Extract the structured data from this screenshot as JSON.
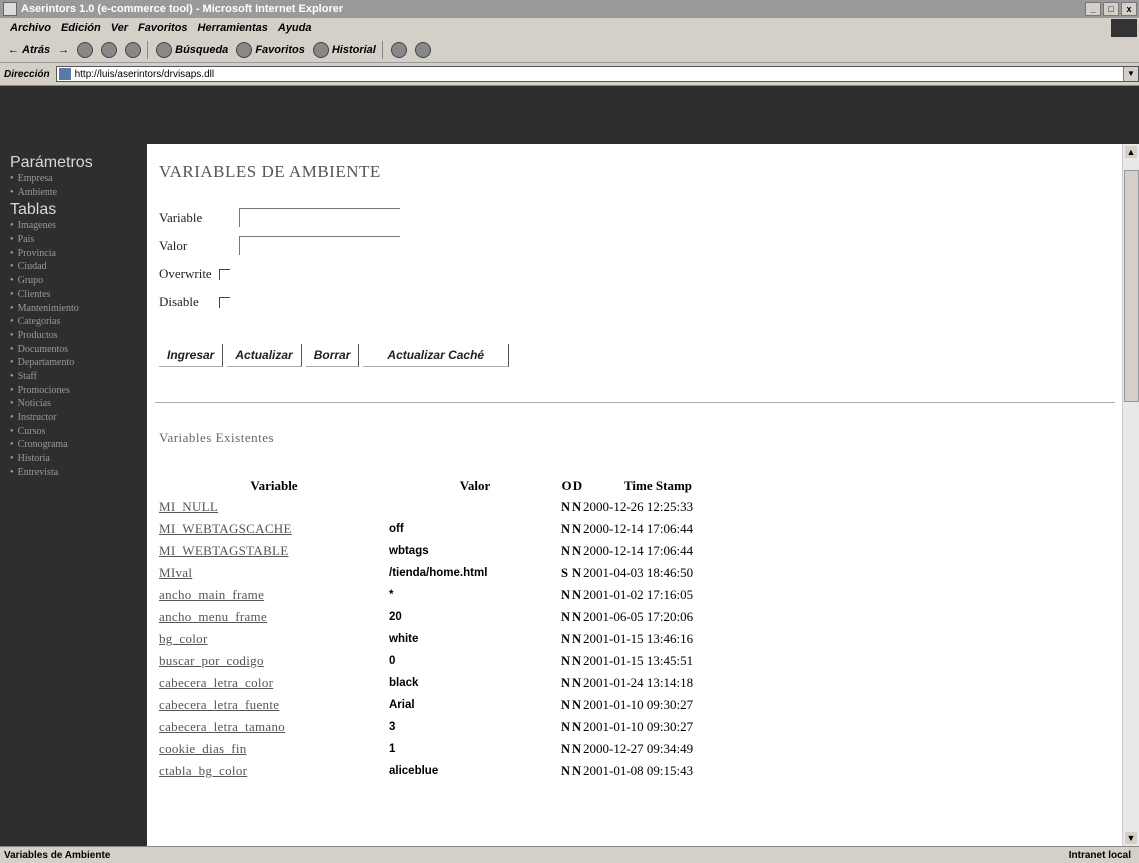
{
  "window": {
    "title": "Aserintors 1.0 (e-commerce tool) - Microsoft Internet Explorer",
    "controls": [
      "_",
      "□",
      "x"
    ]
  },
  "menubar": {
    "items": [
      "Archivo",
      "Edición",
      "Ver",
      "Favoritos",
      "Herramientas",
      "Ayuda"
    ]
  },
  "toolbar": {
    "back_label": "Atrás",
    "search_label": "Búsqueda",
    "favorites_label": "Favoritos",
    "history_label": "Historial"
  },
  "address": {
    "label": "Dirección",
    "url": "http://luis/aserintors/drvisaps.dll"
  },
  "sidebar": {
    "section1_title": "Parámetros",
    "section1_items": [
      "Empresa",
      "Ambiente"
    ],
    "section2_title": "Tablas",
    "section2_items": [
      "Imagenes",
      "Pais",
      "Provincia",
      "Ciudad",
      "Grupo",
      "Clientes",
      "Mantenimiento",
      "Categorias",
      "Productos",
      "Documentos",
      "Departamento",
      "Staff",
      "Promociones",
      "Noticias",
      "Instructor",
      "Cursos",
      "Cronograma",
      "Historia",
      "Entrevista"
    ]
  },
  "form": {
    "page_title": "VARIABLES DE AMBIENTE",
    "variable_label": "Variable",
    "variable_value": "",
    "valor_label": "Valor",
    "valor_value": "",
    "overwrite_label": "Overwrite",
    "overwrite_checked": false,
    "disable_label": "Disable",
    "disable_checked": false
  },
  "buttons": {
    "ingresar": "Ingresar",
    "actualizar": "Actualizar",
    "borrar": "Borrar",
    "actualizar_cache": "Actualizar Caché"
  },
  "existing": {
    "subtitle": "Variables Existentes",
    "headers": {
      "variable": "Variable",
      "valor": "Valor",
      "o": "O",
      "d": "D",
      "timestamp": "Time Stamp"
    },
    "rows": [
      {
        "variable": "MI_NULL",
        "valor": "",
        "o": "N",
        "d": "N",
        "timestamp": "2000-12-26 12:25:33"
      },
      {
        "variable": "MI_WEBTAGSCACHE",
        "valor": "off",
        "o": "N",
        "d": "N",
        "timestamp": "2000-12-14 17:06:44"
      },
      {
        "variable": "MI_WEBTAGSTABLE",
        "valor": "wbtags",
        "o": "N",
        "d": "N",
        "timestamp": "2000-12-14 17:06:44"
      },
      {
        "variable": "MIval",
        "valor": "/tienda/home.html",
        "o": "S",
        "d": "N",
        "timestamp": "2001-04-03 18:46:50"
      },
      {
        "variable": "ancho_main_frame",
        "valor": "*",
        "o": "N",
        "d": "N",
        "timestamp": "2001-01-02 17:16:05"
      },
      {
        "variable": "ancho_menu_frame",
        "valor": "20",
        "o": "N",
        "d": "N",
        "timestamp": "2001-06-05 17:20:06"
      },
      {
        "variable": "bg_color",
        "valor": "white",
        "o": "N",
        "d": "N",
        "timestamp": "2001-01-15 13:46:16"
      },
      {
        "variable": "buscar_por_codigo",
        "valor": "0",
        "o": "N",
        "d": "N",
        "timestamp": "2001-01-15 13:45:51"
      },
      {
        "variable": "cabecera_letra_color",
        "valor": "black",
        "o": "N",
        "d": "N",
        "timestamp": "2001-01-24 13:14:18"
      },
      {
        "variable": "cabecera_letra_fuente",
        "valor": "Arial",
        "o": "N",
        "d": "N",
        "timestamp": "2001-01-10 09:30:27"
      },
      {
        "variable": "cabecera_letra_tamano",
        "valor": "3",
        "o": "N",
        "d": "N",
        "timestamp": "2001-01-10 09:30:27"
      },
      {
        "variable": "cookie_dias_fin",
        "valor": "1",
        "o": "N",
        "d": "N",
        "timestamp": "2000-12-27 09:34:49"
      },
      {
        "variable": "ctabla_bg_color",
        "valor": "aliceblue",
        "o": "N",
        "d": "N",
        "timestamp": "2001-01-08 09:15:43"
      }
    ]
  },
  "status": {
    "text": "Variables de Ambiente",
    "zone": "Intranet local"
  },
  "colors": {
    "sidebar_bg": "#2e2e2e",
    "chrome_bg": "#d4d0c8",
    "titlebar_bg": "#9a9a9a"
  }
}
